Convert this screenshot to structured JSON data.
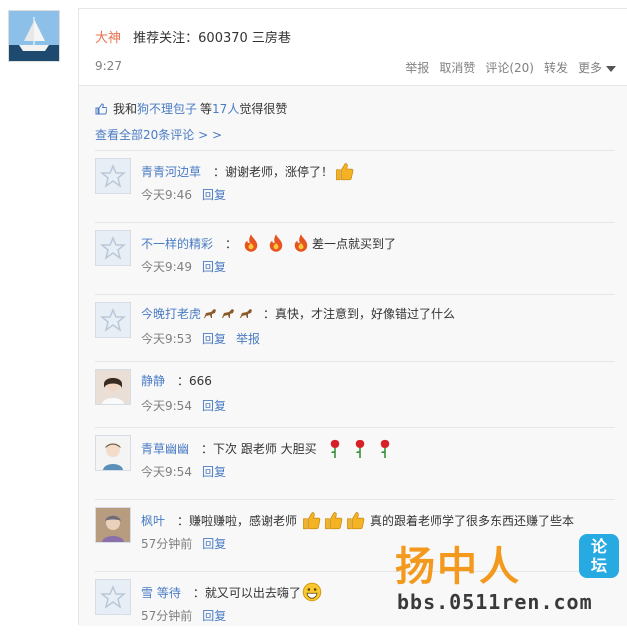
{
  "post": {
    "author": "大神",
    "text": "推荐关注：600370 三房巷",
    "time": "9:27",
    "actions": [
      "举报",
      "取消赞",
      "评论(20)",
      "转发",
      "更多"
    ]
  },
  "likes": {
    "prefix": "我和",
    "user": "狗不理包子",
    "mid": "等",
    "count": "17人",
    "suffix": "觉得很赞"
  },
  "view_all": "查看全部20条评论 > >",
  "comments": [
    {
      "name": "青青河边草",
      "text": "：谢谢老师，涨停了！",
      "time": "今天9:46",
      "reply": "回复",
      "report": ""
    },
    {
      "name": "不一样的精彩",
      "text": "：",
      "text2": "差一点就买到了",
      "time": "今天9:49",
      "reply": "回复",
      "report": ""
    },
    {
      "name": "今晚打老虎",
      "text": "：真快，才注意到，好像错过了什么",
      "time": "今天9:53",
      "reply": "回复",
      "report": "举报"
    },
    {
      "name": "静静",
      "text": "：666",
      "time": "今天9:54",
      "reply": "回复",
      "report": ""
    },
    {
      "name": "青草幽幽",
      "text": "：下次 跟老师 大胆买",
      "time": "今天9:54",
      "reply": "回复",
      "report": ""
    },
    {
      "name": "枫叶",
      "text": "：赚啦赚啦，感谢老师",
      "text2": "真的跟着老师学了很多东西还赚了些本",
      "time": "57分钟前",
      "reply": "回复",
      "report": ""
    },
    {
      "name": "雪 等待",
      "text": "：就又可以出去嗨了",
      "time": "57分钟前",
      "reply": "回复",
      "report": ""
    }
  ],
  "watermark": {
    "title": "扬中人",
    "badge": "论坛",
    "url": "bbs.0511ren.com"
  },
  "colors": {
    "link": "#4a7cc4",
    "accent": "#eb7350",
    "muted": "#808080",
    "wm_orange": "#f39a1e",
    "wm_blue": "#27a9e1"
  }
}
